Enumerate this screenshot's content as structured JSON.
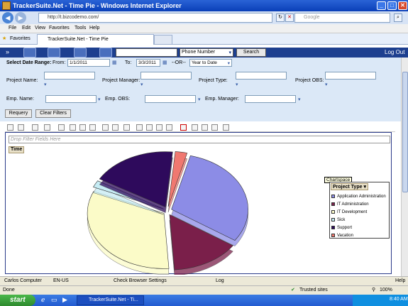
{
  "window": {
    "title": "TrackerSuite.Net - Time Pie - Windows Internet Explorer"
  },
  "browser": {
    "address": "http://t.bizcodemo.com/",
    "search_placeholder": "Google",
    "menu": [
      "File",
      "Edit",
      "View",
      "Favorites",
      "Tools",
      "Help"
    ],
    "favorites_label": "Favorites",
    "tab_label": "TrackerSuite.Net - Time Pie"
  },
  "app": {
    "phone_select": "Phone Number",
    "search_button": "Search",
    "logout": "Log Out"
  },
  "filters": {
    "date_range_label": "Select Date Range:",
    "from_label": "From:",
    "from_value": "1/1/2011",
    "to_label": "To:",
    "to_value": "3/3/2011",
    "or_label": "--OR--",
    "preset_value": "Year to Date",
    "project_name": "Project Name:",
    "project_manager": "Project Manager:",
    "project_type": "Project Type:",
    "project_obs": "Project OBS:",
    "emp_name": "Emp. Name:",
    "emp_obs": "Emp. OBS:",
    "emp_manager": "Emp. Manager:",
    "requery": "Requery",
    "clear_filters": "Clear Filters"
  },
  "pivot": {
    "drop_zone": "Drop Filter Fields Here",
    "data_field": "Time",
    "tooltip": "Chartspace",
    "legend_title": "Project Type"
  },
  "chart_data": {
    "type": "pie",
    "categories": [
      "Application Administration",
      "IT Administration",
      "IT Development",
      "Sick",
      "Support",
      "Vacation"
    ],
    "values": [
      30.5,
      14.5,
      32.5,
      2.0,
      18.0,
      2.5
    ],
    "colors": [
      "#8c8ce6",
      "#7a1f4a",
      "#fbfbc8",
      "#c6ecf4",
      "#2e0a5c",
      "#f07870"
    ],
    "legend_placement": "right"
  },
  "statusbar": {
    "user": "Carlos Computer",
    "locale": "EN-US",
    "check": "Check Browser Settings",
    "log": "Log",
    "help": "Help"
  },
  "ie_status": {
    "done": "Done",
    "zone": "Trusted sites",
    "zoom": "100%"
  },
  "taskbar": {
    "start": "start",
    "task": "TrackerSuite.Net - Ti...",
    "clock": "8:40 AM"
  }
}
